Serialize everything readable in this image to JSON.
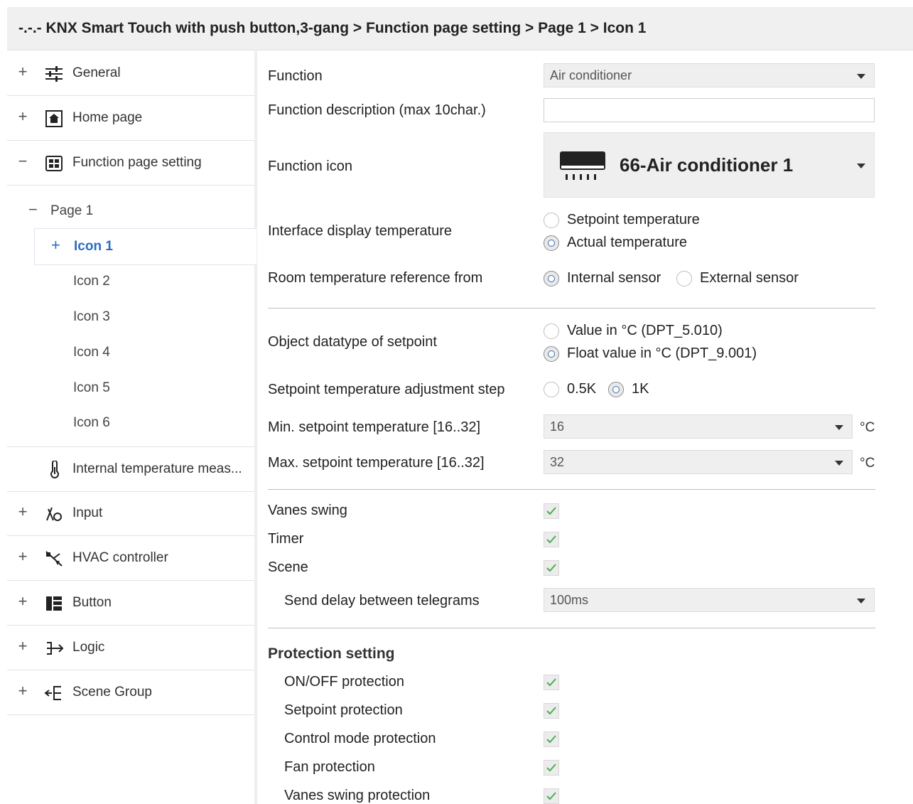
{
  "breadcrumb": "-.-.- KNX Smart Touch with push button,3-gang > Function page setting > Page 1 > Icon 1",
  "sidebar": {
    "items": [
      {
        "expander": "+",
        "icon": "sliders-icon",
        "label": "General"
      },
      {
        "expander": "+",
        "icon": "home-icon",
        "label": "Home page"
      },
      {
        "expander": "−",
        "icon": "grid-icon",
        "label": "Function page setting"
      },
      {
        "expander": "",
        "icon": "thermometer-icon",
        "label": "Internal temperature meas..."
      },
      {
        "expander": "+",
        "icon": "input-icon",
        "label": "Input"
      },
      {
        "expander": "+",
        "icon": "hvac-icon",
        "label": "HVAC controller"
      },
      {
        "expander": "+",
        "icon": "button-icon",
        "label": "Button"
      },
      {
        "expander": "+",
        "icon": "logic-icon",
        "label": "Logic"
      },
      {
        "expander": "+",
        "icon": "scene-group-icon",
        "label": "Scene Group"
      }
    ],
    "page": {
      "expander": "−",
      "label": "Page 1"
    },
    "icons": [
      {
        "expander": "+",
        "label": "Icon 1"
      },
      {
        "label": "Icon 2"
      },
      {
        "label": "Icon 3"
      },
      {
        "label": "Icon 4"
      },
      {
        "label": "Icon 5"
      },
      {
        "label": "Icon 6"
      }
    ]
  },
  "main": {
    "function": {
      "label": "Function",
      "value": "Air conditioner"
    },
    "description": {
      "label": "Function description (max 10char.)",
      "value": ""
    },
    "icon": {
      "label": "Function icon",
      "value": "66-Air conditioner 1"
    },
    "display_temp": {
      "label": "Interface display temperature",
      "opt1": "Setpoint temperature",
      "opt2": "Actual temperature"
    },
    "room_ref": {
      "label": "Room temperature reference from",
      "opt1": "Internal sensor",
      "opt2": "External sensor"
    },
    "datatype": {
      "label": "Object datatype of setpoint",
      "opt1": "Value in °C (DPT_5.010)",
      "opt2": "Float value in °C (DPT_9.001)"
    },
    "step": {
      "label": "Setpoint temperature adjustment step",
      "opt1": "0.5K",
      "opt2": "1K"
    },
    "min_sp": {
      "label": "Min. setpoint temperature [16..32]",
      "value": "16",
      "unit": "°C"
    },
    "max_sp": {
      "label": "Max. setpoint temperature [16..32]",
      "value": "32",
      "unit": "°C"
    },
    "vanes": {
      "label": "Vanes swing"
    },
    "timer": {
      "label": "Timer"
    },
    "scene": {
      "label": "Scene"
    },
    "delay": {
      "label": "Send delay between telegrams",
      "value": "100ms"
    },
    "protection": {
      "title": "Protection setting",
      "items": [
        "ON/OFF protection",
        "Setpoint protection",
        "Control mode protection",
        "Fan protection",
        "Vanes swing protection"
      ]
    }
  }
}
